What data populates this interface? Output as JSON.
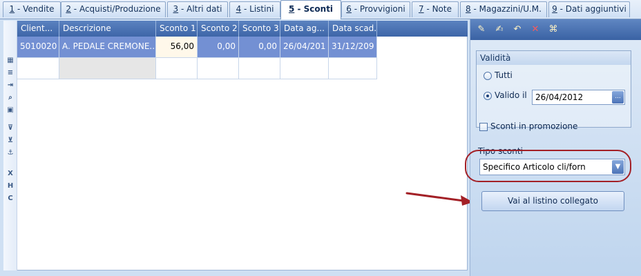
{
  "tabs": [
    {
      "num": "1",
      "label": " - Vendite"
    },
    {
      "num": "2",
      "label": " - Acquisti/Produzione"
    },
    {
      "num": "3",
      "label": " - Altri dati"
    },
    {
      "num": "4",
      "label": " - Listini"
    },
    {
      "num": "5",
      "label": " - Sconti"
    },
    {
      "num": "6",
      "label": " - Provvigioni"
    },
    {
      "num": "7",
      "label": " - Note"
    },
    {
      "num": "8",
      "label": " - Magazzini/U.M."
    },
    {
      "num": "9",
      "label": " - Dati aggiuntivi"
    }
  ],
  "active_tab": "5 - Sconti",
  "left_toolbar": [
    {
      "icon": "grid-options-icon",
      "glyph": "▦"
    },
    {
      "icon": "list-icon",
      "glyph": "≡"
    },
    {
      "icon": "insert-row-icon",
      "glyph": "⇥"
    },
    {
      "icon": "zoom-icon",
      "glyph": "⌕"
    },
    {
      "icon": "image-icon",
      "glyph": "▣"
    },
    {
      "icon": "filter-icon",
      "glyph": "⊽"
    },
    {
      "icon": "filter-clear-icon",
      "glyph": "⊻"
    },
    {
      "icon": "anchor-icon",
      "glyph": "⚓"
    },
    {
      "icon": "export-x-icon",
      "glyph": "X"
    },
    {
      "icon": "export-h-icon",
      "glyph": "H"
    },
    {
      "icon": "export-c-icon",
      "glyph": "C"
    }
  ],
  "grid": {
    "columns": [
      "Client...",
      "Descrizione",
      "Sconto 1",
      "Sconto 2",
      "Sconto 3",
      "Data ag...",
      "Data scad."
    ],
    "rows": [
      [
        "5010020",
        "A. PEDALE CREMONE...",
        "56,00",
        "0,00",
        "0,00",
        "26/04/201",
        "31/12/209"
      ]
    ]
  },
  "right_toolbar": [
    {
      "icon": "edit-icon",
      "glyph": "✎"
    },
    {
      "icon": "save-icon",
      "glyph": "✍"
    },
    {
      "icon": "undo-icon",
      "glyph": "↶"
    },
    {
      "icon": "delete-icon",
      "glyph": "✕"
    },
    {
      "icon": "binoculars-icon",
      "glyph": "⌘"
    }
  ],
  "validita": {
    "title": "Validità",
    "option_all": "Tutti",
    "option_valid": "Valido il",
    "selected": "Valido il",
    "date": "26/04/2012",
    "date_button": "..."
  },
  "promo_checkbox": {
    "label": "Sconti in promozione",
    "checked": false
  },
  "tipo_sconti": {
    "label": "Tipo sconti",
    "value": "Specifico Articolo cli/forn"
  },
  "link_button": "Vai al listino collegato",
  "colors": {
    "header_blue": "#3e66a8",
    "selected_row": "#7390d3",
    "annotation_red": "#a32026"
  }
}
